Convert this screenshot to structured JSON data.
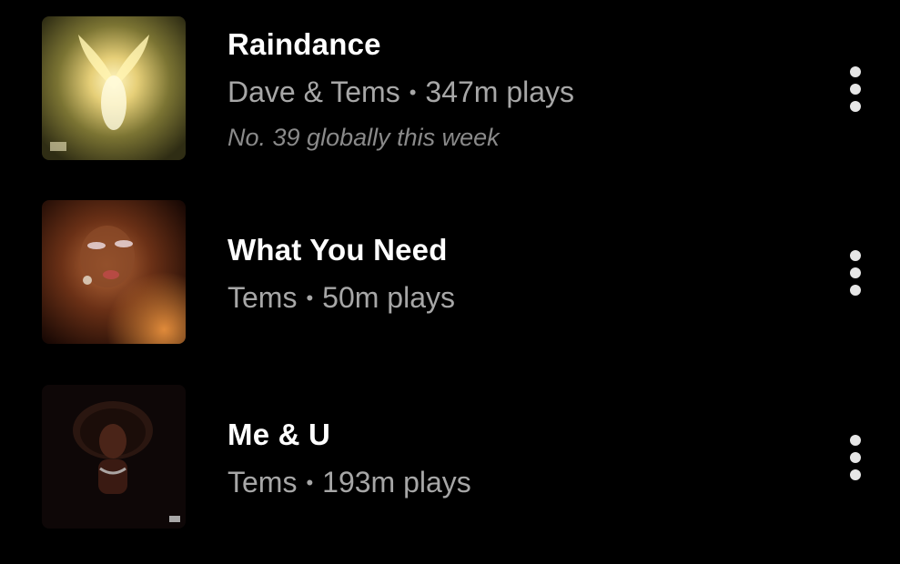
{
  "colors": {
    "background": "#000000",
    "title": "#ffffff",
    "subtitle": "#a7a7a7",
    "note": "#8a8a8a",
    "menu_dots": "#e6e6e6"
  },
  "tracks": [
    {
      "title": "Raindance",
      "artist": "Dave & Tems",
      "separator": "•",
      "plays": "347m plays",
      "note": "No. 39 globally this week",
      "art_icon": "album-art-glowing-angel",
      "menu_icon": "more-vertical-icon"
    },
    {
      "title": "What You Need",
      "artist": "Tems",
      "separator": "•",
      "plays": "50m plays",
      "art_icon": "album-art-portrait-warm",
      "menu_icon": "more-vertical-icon"
    },
    {
      "title": "Me & U",
      "artist": "Tems",
      "separator": "•",
      "plays": "193m plays",
      "art_icon": "album-art-portrait-dark",
      "menu_icon": "more-vertical-icon"
    }
  ]
}
